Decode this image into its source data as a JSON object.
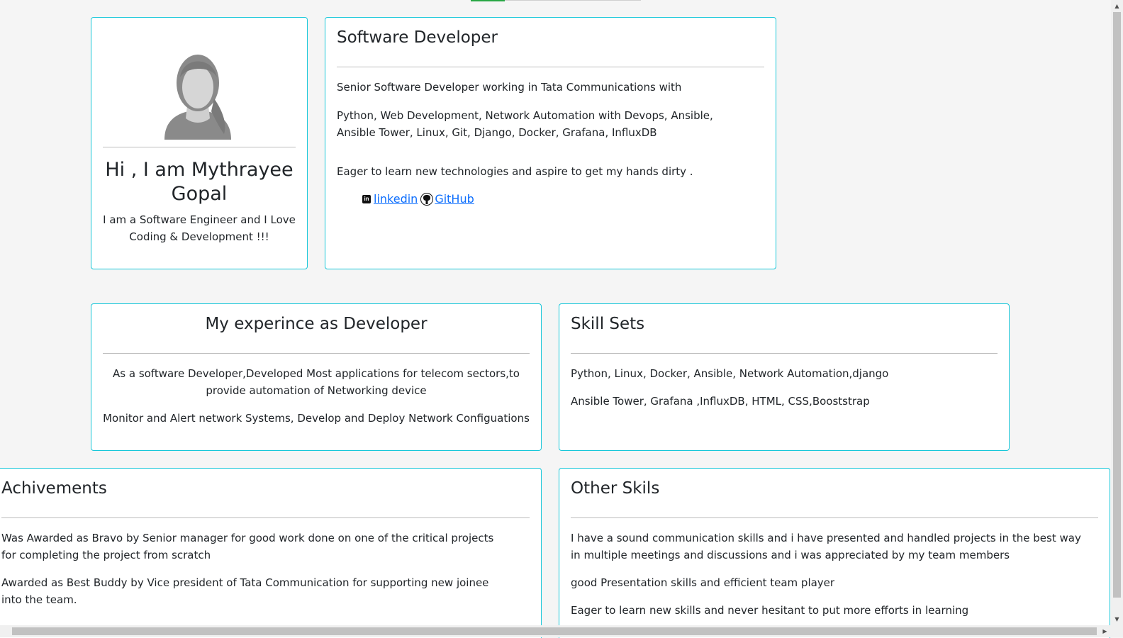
{
  "profile": {
    "name": "Hi , I am Mythrayee Gopal",
    "tagline": "I am a Software Engineer and I Love Coding & Development !!!"
  },
  "about": {
    "title": "Software Developer",
    "line1": "Senior Software Developer working in Tata Communications with",
    "line2": "Python, Web Development, Network Automation with Devops, Ansible, Ansible Tower, Linux, Git, Django, Docker, Grafana, InfluxDB",
    "line3": "Eager to learn new technologies and aspire to get my hands dirty .",
    "linkedin_label": "linkedin",
    "github_label": "GitHub"
  },
  "experience": {
    "title": "My experince as Developer",
    "line1": "As a software Developer,Developed Most applications for telecom sectors,to provide automation of Networking device",
    "line2": "Monitor and Alert network Systems, Develop and Deploy Network Configuations"
  },
  "skills": {
    "title": "Skill Sets",
    "line1": "Python, Linux, Docker, Ansible, Network Automation,django",
    "line2": "Ansible Tower, Grafana ,InfluxDB, HTML, CSS,Booststrap"
  },
  "achievements": {
    "title": "Achivements",
    "line1": "Was Awarded as Bravo by Senior manager for good work done on one of the critical projects for completing the project from scratch",
    "line2": "Awarded as Best Buddy by Vice president of Tata Communication for supporting new joinee into the team."
  },
  "other": {
    "title": "Other Skils",
    "line1": "I have a sound communication skills and i have presented and handled projects in the best way in multiple meetings and discussions and i was appreciated by my team members",
    "line2": "good Presentation skills and efficient team player",
    "line3": "Eager to learn new skills and never hesitant to put more efforts in learning"
  },
  "icons": {
    "avatar": "female-avatar-icon",
    "linkedin": "linkedin-icon",
    "github": "github-icon"
  },
  "colors": {
    "card_border": "#17c7d9",
    "link": "#0d6efd",
    "accent": "#28a745",
    "background": "#f5f5f5"
  }
}
